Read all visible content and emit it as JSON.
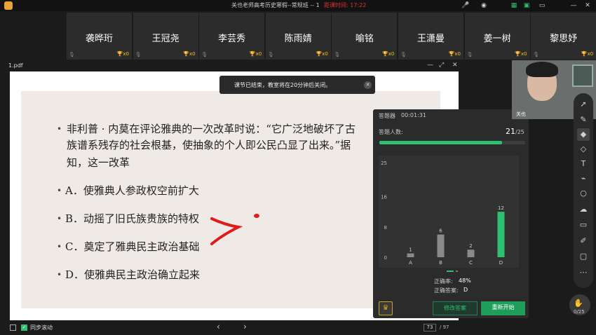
{
  "titlebar": {
    "title": "关也老师高考历史寒假--常规班 -- 1",
    "countdown": "距课时间: 17:22",
    "icons": [
      "mic-icon",
      "headset-icon",
      "grid-icon",
      "screen-icon",
      "minimize-icon",
      "close-icon"
    ]
  },
  "participants": [
    {
      "name": "袭晔珩",
      "score": "x0"
    },
    {
      "name": "王冠尧",
      "score": "x0"
    },
    {
      "name": "李芸秀",
      "score": "x0"
    },
    {
      "name": "陈雨婧",
      "score": "x0"
    },
    {
      "name": "喻铭",
      "score": "x0"
    },
    {
      "name": "王潇曼",
      "score": "x0"
    },
    {
      "name": "姜一树",
      "score": "x0"
    },
    {
      "name": "黎思妤",
      "score": "x0"
    }
  ],
  "file": {
    "name": "1.pdf"
  },
  "toast": {
    "text": "课节已结束，教室将在20分钟后关闭。",
    "close": "✕"
  },
  "slide": {
    "question_line1": "非利普 · 内莫在评论雅典的一次改革时说：“它广泛地破坏了古",
    "question_line2": "族谱系残存的社会根基，使抽象的个人即公民凸显了出来。”据",
    "question_line3": "知，这一改革",
    "option_a": "A．使雅典人参政权空前扩大",
    "option_b": "B．动摇了旧氏族贵族的特权",
    "option_c": "C．奠定了雅典民主政治基础",
    "option_d": "D．使雅典民主政治确立起来",
    "bullet": "•"
  },
  "quiz": {
    "title": "答题器",
    "timer": "00:01:31",
    "respondents_label": "答题人数:",
    "respondents": "21",
    "respondents_total": "/25",
    "progress": 0.84,
    "correct_rate_label": "正确率:",
    "correct_rate": "48%",
    "correct_answer_label": "正确答案:",
    "correct_answer": "D",
    "modify_button": "修改答案",
    "restart_button": "重新开始"
  },
  "chart_data": {
    "type": "bar",
    "categories": [
      "A",
      "B",
      "C",
      "D"
    ],
    "values": [
      1,
      6,
      2,
      12
    ],
    "yticks": [
      0,
      8,
      16,
      25
    ],
    "ylim": [
      0,
      25
    ],
    "highlight": "D",
    "colors": {
      "default": "#8a8a8a",
      "highlight": "#2fbf71"
    }
  },
  "camera": {
    "label": "关也"
  },
  "right_toolbar": [
    "pointer-icon",
    "pen-icon",
    "highlighter-icon",
    "eraser-icon",
    "text-icon",
    "laser-icon",
    "shape-icon",
    "cloud-icon",
    "toolbox-icon",
    "edit-icon",
    "chat-icon",
    "more-icon"
  ],
  "hand": {
    "count": "0/25"
  },
  "bottom": {
    "sync_label": "同步滚动",
    "prev": "‹",
    "next": "›",
    "page": "73",
    "total": "/ 97"
  }
}
